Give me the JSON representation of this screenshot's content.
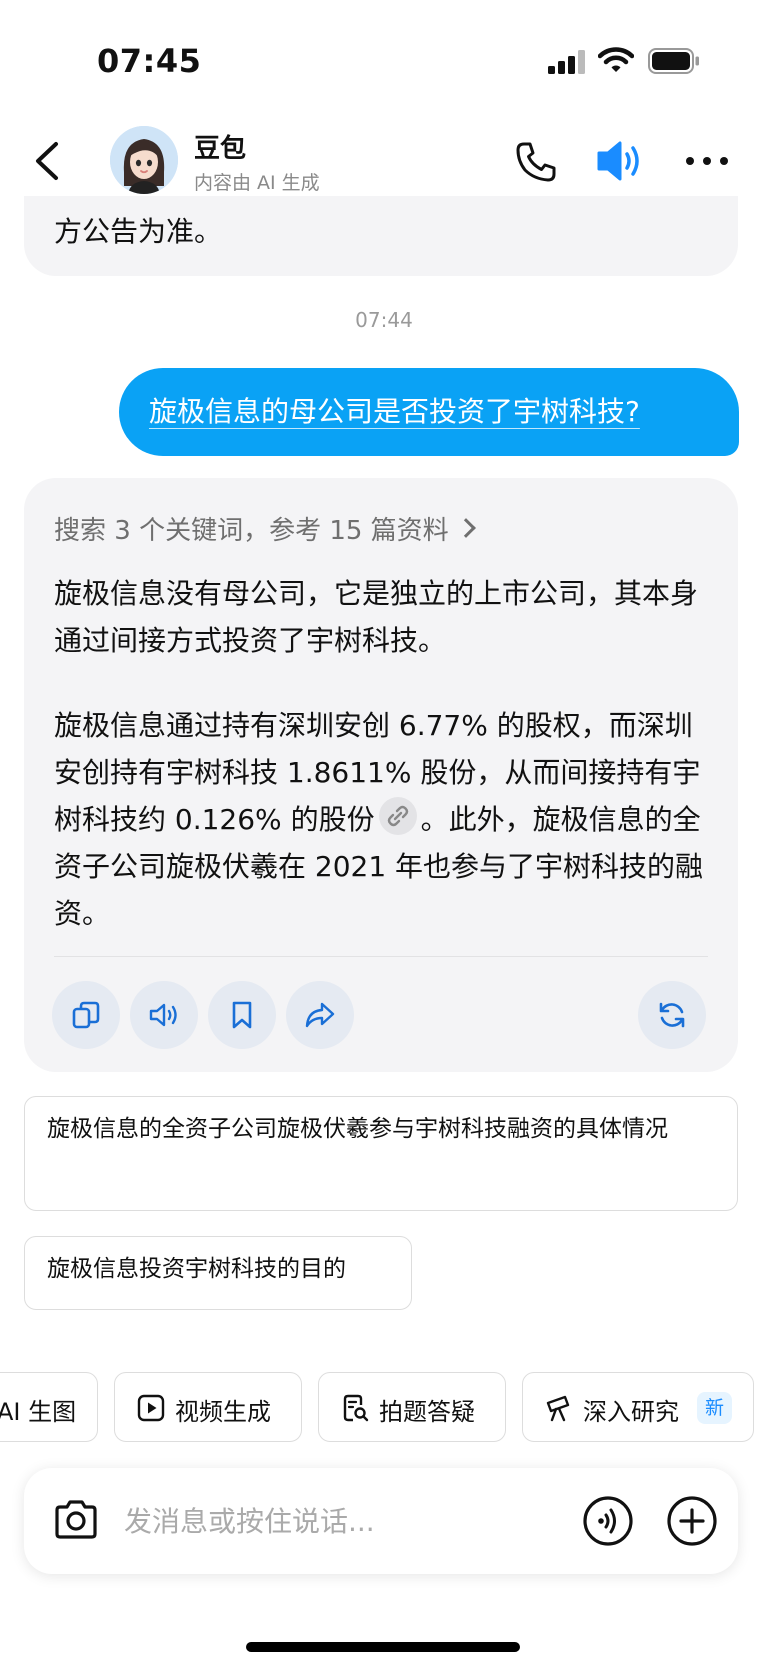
{
  "status_bar": {
    "time": "07:45"
  },
  "header": {
    "name": "豆包",
    "subtitle": "内容由 AI 生成",
    "speaker_color": "#1a8cff"
  },
  "messages": {
    "previous_tail": "方公告为准。",
    "timestamp": "07:44",
    "user_question": "旋极信息的母公司是否投资了宇树科技?",
    "bot": {
      "search_summary": "搜索 3 个关键词，参考 15 篇资料",
      "paragraph1": "旋极信息没有母公司，它是独立的上市公司，其本身通过间接方式投资了宇树科技。",
      "paragraph2_part1": "旋极信息通过持有深圳安创 6.77% 的股权，而深圳安创持有宇树科技 1.8611% 股份，从而间接持有宇树科技约 0.126% 的股份",
      "paragraph2_part2": "。此外，旋极信息的全资子公司旋极伏羲在 2021 年也参与了宇树科技的融资。"
    }
  },
  "suggestions": [
    "旋极信息的全资子公司旋极伏羲参与宇树科技融资的具体情况",
    "旋极信息投资宇树科技的目的"
  ],
  "tools": [
    {
      "label": "AI 生图"
    },
    {
      "label": "视频生成"
    },
    {
      "label": "拍题答疑"
    },
    {
      "label": "深入研究",
      "badge": "新"
    }
  ],
  "input": {
    "placeholder": "发消息或按住说话..."
  },
  "colors": {
    "user_bubble": "#0aa2f5",
    "bot_bubble": "#f4f4f6",
    "accent": "#1a8cff"
  }
}
